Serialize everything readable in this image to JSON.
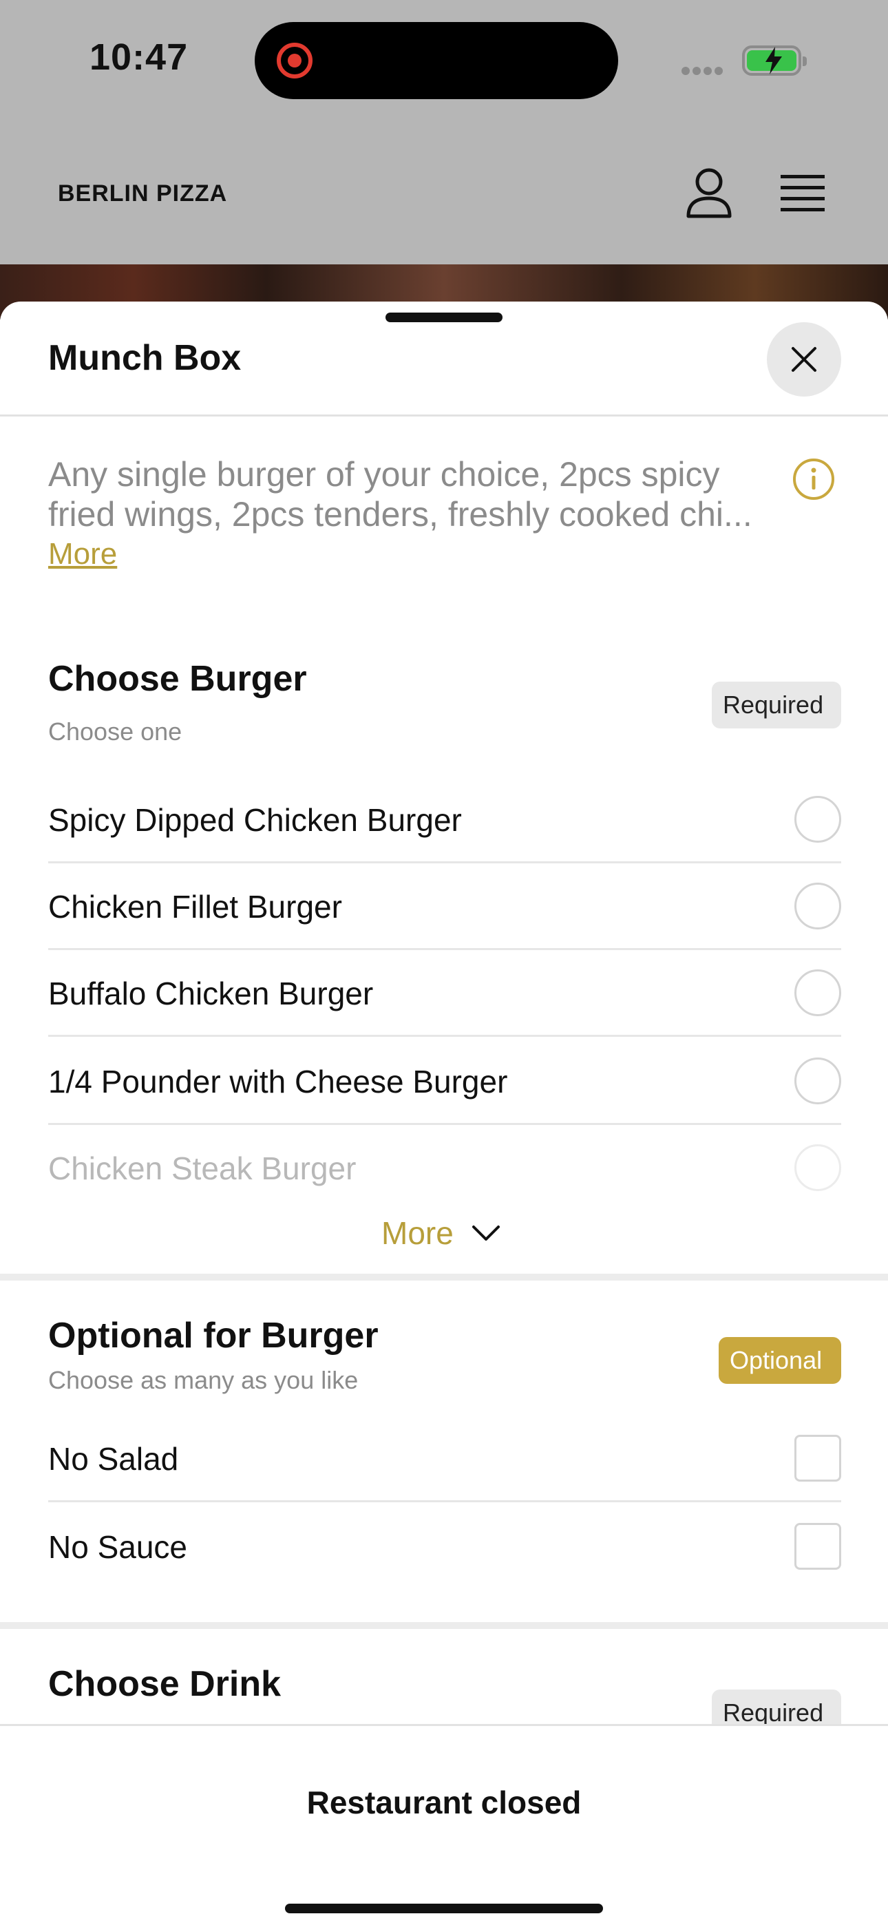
{
  "status_bar": {
    "time": "10:47"
  },
  "header": {
    "brand": "BERLIN PIZZA"
  },
  "sheet": {
    "title": "Munch Box",
    "description_line1": "Any single burger of your choice, 2pcs spicy",
    "description_line2": "fried wings, 2pcs tenders, freshly cooked chi...",
    "more_link": "More"
  },
  "choose_burger": {
    "title": "Choose Burger",
    "subtitle": "Choose one",
    "badge": "Required",
    "options": [
      "Spicy Dipped Chicken Burger",
      "Chicken Fillet Burger",
      "Buffalo Chicken Burger",
      "1/4 Pounder with Cheese Burger",
      "Chicken Steak Burger"
    ],
    "more_label": "More"
  },
  "optional_burger": {
    "title": "Optional for Burger",
    "subtitle": "Choose as many as you like",
    "badge": "Optional",
    "options": [
      "No Salad",
      "No Sauce"
    ]
  },
  "choose_drink": {
    "title": "Choose Drink",
    "badge": "Required"
  },
  "bottom_bar": {
    "status": "Restaurant closed"
  },
  "colors": {
    "accent": "#c9a83e",
    "link": "#b79e3a",
    "battery": "#39c24a",
    "record": "#e23a2f"
  }
}
